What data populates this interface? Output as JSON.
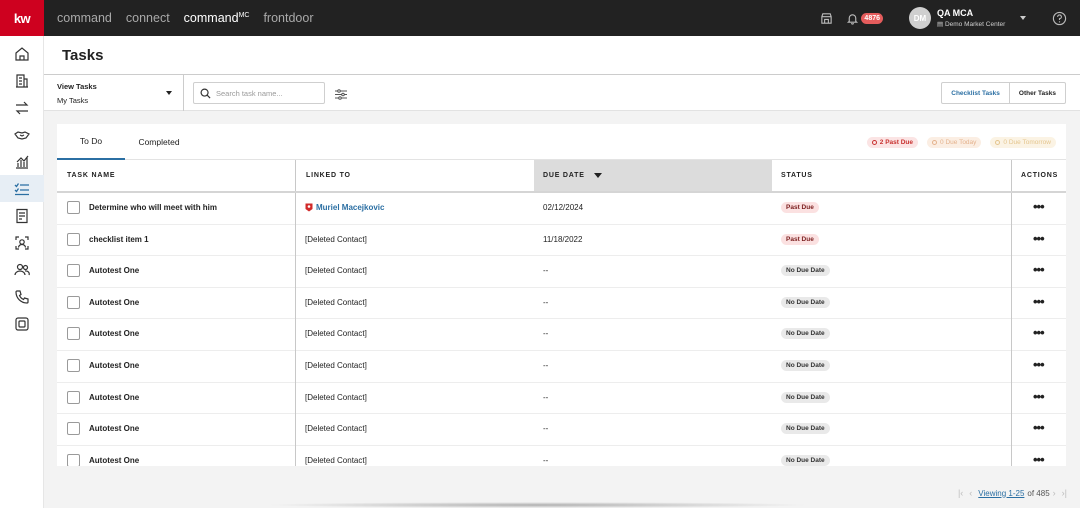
{
  "topbar": {
    "logo": "kw",
    "nav": [
      {
        "label": "command",
        "sup": ""
      },
      {
        "label": "connect",
        "sup": ""
      },
      {
        "label": "command",
        "sup": "MC"
      },
      {
        "label": "frontdoor",
        "sup": ""
      }
    ],
    "active_nav_index": 2,
    "notification_count": "4876",
    "avatar_initials": "DM",
    "user_name": "QA MCA",
    "market_center": "Demo Market Center"
  },
  "sidebar": {
    "items": [
      "home-icon",
      "building-icon",
      "transfer-icon",
      "handshake-icon",
      "chart-icon",
      "tasks-icon",
      "document-icon",
      "contact-search-icon",
      "people-icon",
      "phone-icon",
      "gallery-icon"
    ],
    "active_index": 5
  },
  "header": {
    "title": "Tasks"
  },
  "filter": {
    "view_label": "View Tasks",
    "view_value": "My Tasks",
    "search_placeholder": "Search task name...",
    "checklist_tasks_label": "Checklist Tasks",
    "other_tasks_label": "Other Tasks"
  },
  "tabs": {
    "todo": "To Do",
    "completed": "Completed"
  },
  "pills": {
    "past_due": "2 Past Due",
    "due_today": "0 Due Today",
    "due_tomorrow": "0 Due Tomorrow"
  },
  "table": {
    "columns": {
      "name": "TASK NAME",
      "linked": "LINKED TO",
      "due": "DUE DATE",
      "status": "STATUS",
      "actions": "ACTIONS"
    },
    "rows": [
      {
        "name": "Determine who will meet with him",
        "linked": "Muriel Macejkovic",
        "linked_is_contact": true,
        "due": "02/12/2024",
        "status": "Past Due",
        "status_type": "past"
      },
      {
        "name": "checklist item 1",
        "linked": "[Deleted Contact]",
        "linked_is_contact": false,
        "due": "11/18/2022",
        "status": "Past Due",
        "status_type": "past"
      },
      {
        "name": "Autotest One",
        "linked": "[Deleted Contact]",
        "linked_is_contact": false,
        "due": "--",
        "status": "No Due Date",
        "status_type": "none"
      },
      {
        "name": "Autotest One",
        "linked": "[Deleted Contact]",
        "linked_is_contact": false,
        "due": "--",
        "status": "No Due Date",
        "status_type": "none"
      },
      {
        "name": "Autotest One",
        "linked": "[Deleted Contact]",
        "linked_is_contact": false,
        "due": "--",
        "status": "No Due Date",
        "status_type": "none"
      },
      {
        "name": "Autotest One",
        "linked": "[Deleted Contact]",
        "linked_is_contact": false,
        "due": "--",
        "status": "No Due Date",
        "status_type": "none"
      },
      {
        "name": "Autotest One",
        "linked": "[Deleted Contact]",
        "linked_is_contact": false,
        "due": "--",
        "status": "No Due Date",
        "status_type": "none"
      },
      {
        "name": "Autotest One",
        "linked": "[Deleted Contact]",
        "linked_is_contact": false,
        "due": "--",
        "status": "No Due Date",
        "status_type": "none"
      },
      {
        "name": "Autotest One",
        "linked": "[Deleted Contact]",
        "linked_is_contact": false,
        "due": "--",
        "status": "No Due Date",
        "status_type": "none"
      }
    ]
  },
  "pager": {
    "viewing": "Viewing 1-25",
    "total": "of 485"
  },
  "colors": {
    "brand_red": "#ce011f",
    "link_blue": "#2b6fa3",
    "topbar": "#222222"
  }
}
